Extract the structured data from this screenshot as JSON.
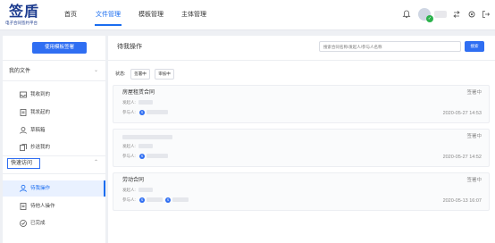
{
  "logo": {
    "main": "签盾",
    "sub": "电子合同签约平台"
  },
  "nav": {
    "items": [
      "首页",
      "文件管理",
      "模板管理",
      "主体管理"
    ],
    "active_index": 1
  },
  "header_icons": [
    "bell-icon",
    "switch-icon",
    "settings-icon",
    "logout-icon"
  ],
  "sidebar": {
    "primary_button": "使用模板签署",
    "my_files": {
      "title": "我的文件",
      "items": [
        {
          "label": "我收到的",
          "icon": "inbox-icon"
        },
        {
          "label": "我发起的",
          "icon": "document-icon"
        },
        {
          "label": "草稿箱",
          "icon": "draft-icon"
        },
        {
          "label": "抄送我的",
          "icon": "cc-icon"
        }
      ]
    },
    "quick_view": {
      "title": "快速访问",
      "items": [
        {
          "label": "待我操作",
          "icon": "user-icon",
          "active": true
        },
        {
          "label": "待他人操作",
          "icon": "document-icon",
          "active": false
        },
        {
          "label": "已完成",
          "icon": "check-circle-icon",
          "active": false
        }
      ]
    }
  },
  "main": {
    "title": "待我操作",
    "search": {
      "placeholder": "搜索合同名称/发起人/参与人名称",
      "button": "搜索"
    },
    "status_label": "状态:",
    "filters": [
      "签署中",
      "审核中"
    ],
    "cards": [
      {
        "title": "房屋租赁合同",
        "status": "签署中",
        "initiator_label": "发起人:",
        "participant_label": "参与人:",
        "date": "2020-05-27 14:53"
      },
      {
        "title": "",
        "status": "签署中",
        "initiator_label": "发起人:",
        "participant_label": "参与人:",
        "date": "2020-05-27 14:52"
      },
      {
        "title": "劳动合同",
        "status": "签署中",
        "initiator_label": "发起人:",
        "participant_label": "参与人:",
        "date": "2020-05-13 16:07"
      }
    ]
  }
}
